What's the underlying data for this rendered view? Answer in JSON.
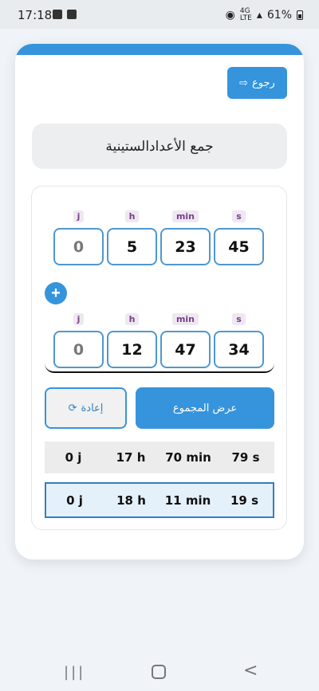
{
  "status_bar": {
    "time": "17:18",
    "battery": "61%",
    "network_top": "4G",
    "network_bottom": "LTE"
  },
  "app": {
    "back_button": {
      "label": "رجوع",
      "icon": "sign-out-icon"
    },
    "title": "جمع الأعدادالستينية",
    "units": {
      "days": "j",
      "hours": "h",
      "minutes": "min",
      "seconds": "s"
    },
    "input_row_1": {
      "days": "0",
      "hours": "5",
      "minutes": "23",
      "seconds": "45"
    },
    "add_button": {
      "label": "+"
    },
    "input_row_2": {
      "days": "0",
      "hours": "12",
      "minutes": "47",
      "seconds": "34"
    },
    "sum_button": {
      "label": "عرض المجموع"
    },
    "reset_button": {
      "label": "إعادة",
      "icon": "refresh-icon"
    },
    "raw_result": {
      "days": "0 j",
      "hours": "17 h",
      "minutes": "70 min",
      "seconds": "79 s"
    },
    "normalized_result": {
      "days": "0 j",
      "hours": "18 h",
      "minutes": "11 min",
      "seconds": "19 s"
    },
    "accent_color": "#3694dc",
    "unit_label_color": "#7d3e8c"
  },
  "nav_bar": {
    "recents": "|||",
    "home": "home",
    "back": "<"
  }
}
